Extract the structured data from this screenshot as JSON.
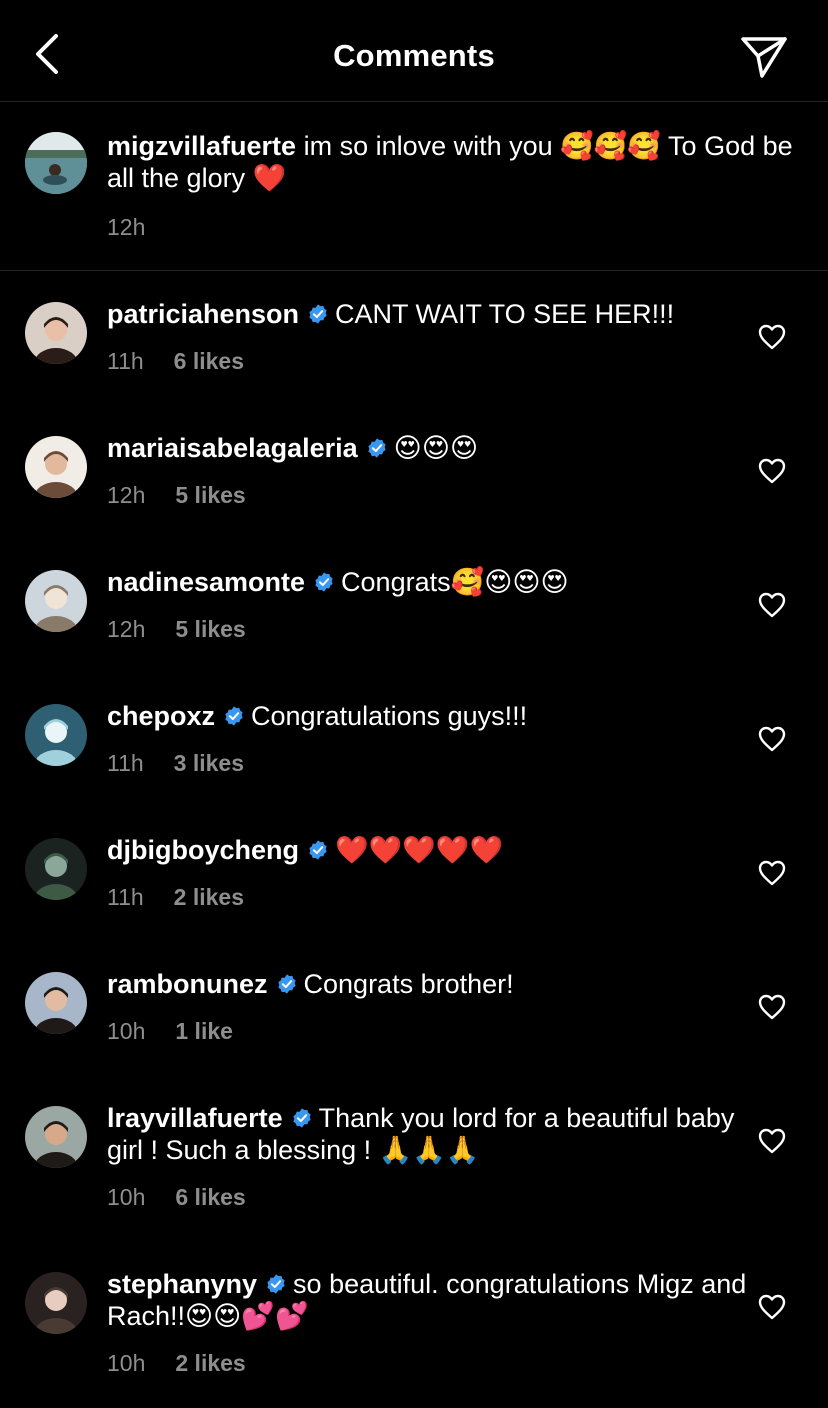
{
  "header": {
    "title": "Comments",
    "back_icon": "chevron-left-icon",
    "send_icon": "paper-plane-icon"
  },
  "caption": {
    "username": "migzvillafuerte",
    "text": "im so inlove with you 🥰🥰🥰 To God be all the glory ❤️",
    "time": "12h"
  },
  "comments": [
    {
      "username": "patriciahenson",
      "verified": true,
      "text": "CANT WAIT TO SEE HER!!!",
      "time": "11h",
      "likes": "6 likes"
    },
    {
      "username": "mariaisabelagaleria",
      "verified": true,
      "text": "😍😍😍",
      "time": "12h",
      "likes": "5 likes"
    },
    {
      "username": "nadinesamonte",
      "verified": true,
      "text": "Congrats🥰😍😍😍",
      "time": "12h",
      "likes": "5 likes"
    },
    {
      "username": "chepoxz",
      "verified": true,
      "text": "Congratulations guys!!!",
      "time": "11h",
      "likes": "3 likes"
    },
    {
      "username": "djbigboycheng",
      "verified": true,
      "text": "❤️❤️❤️❤️❤️",
      "time": "11h",
      "likes": "2 likes"
    },
    {
      "username": "rambonunez",
      "verified": true,
      "text": "Congrats brother!",
      "time": "10h",
      "likes": "1 like"
    },
    {
      "username": "lrayvillafuerte",
      "verified": true,
      "text": "Thank you lord for a beautiful baby girl ! Such a blessing ! 🙏🙏🙏",
      "time": "10h",
      "likes": "6 likes"
    },
    {
      "username": "stephanyny",
      "verified": true,
      "text": "so beautiful. congratulations Migz and Rach!!😍😍💕💕",
      "time": "10h",
      "likes": "2 likes"
    }
  ],
  "colors": {
    "background": "#000000",
    "text": "#ffffff",
    "secondary": "#8e8e8e",
    "verified": "#3897f0",
    "divider": "#262626"
  },
  "icons": {
    "verified": "verified-badge-icon",
    "like": "heart-outline-icon"
  }
}
